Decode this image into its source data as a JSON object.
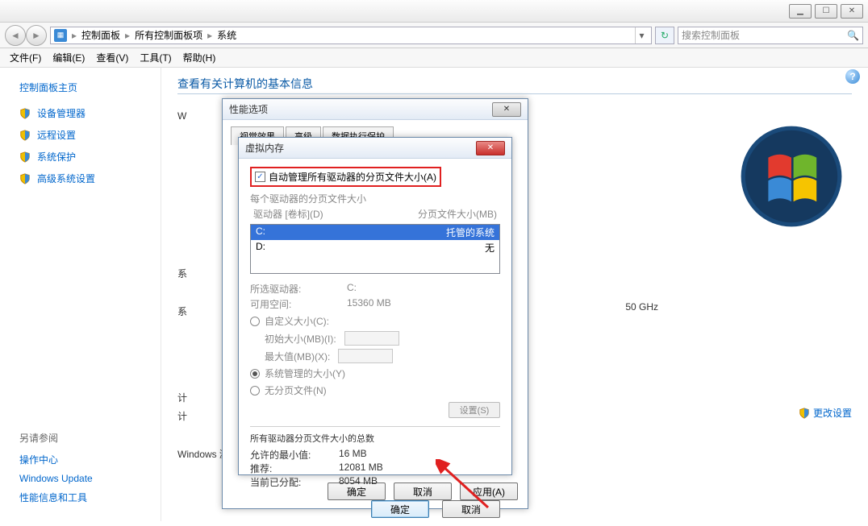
{
  "window": {
    "min": "min",
    "max": "max",
    "close": "close"
  },
  "breadcrumb": {
    "root": "控制面板",
    "mid": "所有控制面板项",
    "leaf": "系统"
  },
  "search": {
    "placeholder": "搜索控制面板"
  },
  "menu": {
    "file": "文件(F)",
    "edit": "编辑(E)",
    "view": "查看(V)",
    "tools": "工具(T)",
    "help": "帮助(H)"
  },
  "sidebar": {
    "home": "控制面板主页",
    "items": [
      "设备管理器",
      "远程设置",
      "系统保护",
      "高级系统设置"
    ],
    "see_also_label": "另请参阅",
    "see_also": [
      "操作中心",
      "Windows Update",
      "性能信息和工具"
    ]
  },
  "main": {
    "heading": "查看有关计算机的基本信息",
    "ghz": "50 GHz",
    "change_settings": "更改设置",
    "activation": "Windows 激活",
    "partial_w": "W",
    "partial_sys": "系",
    "partial_sys2": "系",
    "partial_plan": "计",
    "partial_plan2": "计"
  },
  "dlg1": {
    "title": "性能选项",
    "tabs": [
      "视觉效果",
      "高级",
      "数据执行保护"
    ],
    "ok": "确定",
    "cancel": "取消",
    "apply": "应用(A)"
  },
  "dlg2": {
    "title": "虚拟内存",
    "auto_manage": "自动管理所有驱动器的分页文件大小(A)",
    "group1": "每个驱动器的分页文件大小",
    "col1": "驱动器 [卷标](D)",
    "col2": "分页文件大小(MB)",
    "drives": [
      {
        "letter": "C:",
        "val": "托管的系统"
      },
      {
        "letter": "D:",
        "val": "无"
      }
    ],
    "selected_drive_label": "所选驱动器:",
    "selected_drive_value": "C:",
    "free_space_label": "可用空间:",
    "free_space_value": "15360 MB",
    "custom_size": "自定义大小(C):",
    "initial_size": "初始大小(MB)(I):",
    "max_size": "最大值(MB)(X):",
    "system_managed": "系统管理的大小(Y)",
    "no_paging": "无分页文件(N)",
    "set_btn": "设置(S)",
    "totals_title": "所有驱动器分页文件大小的总数",
    "min_allowed_label": "允许的最小值:",
    "min_allowed_value": "16 MB",
    "recommended_label": "推荐:",
    "recommended_value": "12081 MB",
    "current_label": "当前已分配:",
    "current_value": "8054 MB",
    "ok": "确定",
    "cancel": "取消"
  }
}
